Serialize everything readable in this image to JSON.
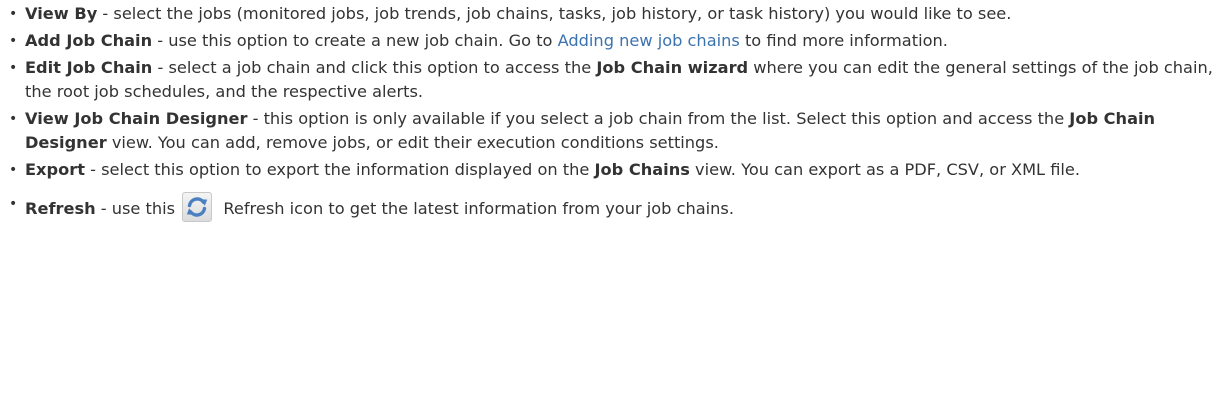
{
  "items": {
    "view_by": {
      "title": "View By",
      "text": " - select the jobs (monitored jobs, job trends, job chains, tasks, job history, or task history) you would like to see."
    },
    "add_job_chain": {
      "title": "Add Job Chain",
      "text1": " - use this option to create a new job chain. Go to ",
      "link": "Adding new job chains",
      "text2": " to find more information."
    },
    "edit_job_chain": {
      "title": "Edit Job Chain",
      "text1": " - select a job chain and click this option to access the ",
      "bold": "Job Chain wizard",
      "text2": " where you can edit the general settings of the job chain, the root job schedules, and the respective alerts."
    },
    "view_designer": {
      "title": "View Job Chain Designer",
      "text1": " - this option is only available if you select a job chain from the list. Select this option and access the ",
      "bold": "Job Chain Designer",
      "text2": " view. You can add, remove jobs, or edit their execution conditions settings."
    },
    "export": {
      "title": "Export",
      "text1": " - select this option to export the information displayed on the ",
      "bold": "Job Chains",
      "text2": " view. You can export as a PDF, CSV, or XML file."
    },
    "refresh": {
      "title": "Refresh",
      "text1": " - use this ",
      "text2": " Refresh icon to get the latest information from your job chains.",
      "icon": "refresh-icon",
      "icon_color": "#4a7fc0"
    }
  },
  "link_color": "#3b73af",
  "bullet": "•"
}
